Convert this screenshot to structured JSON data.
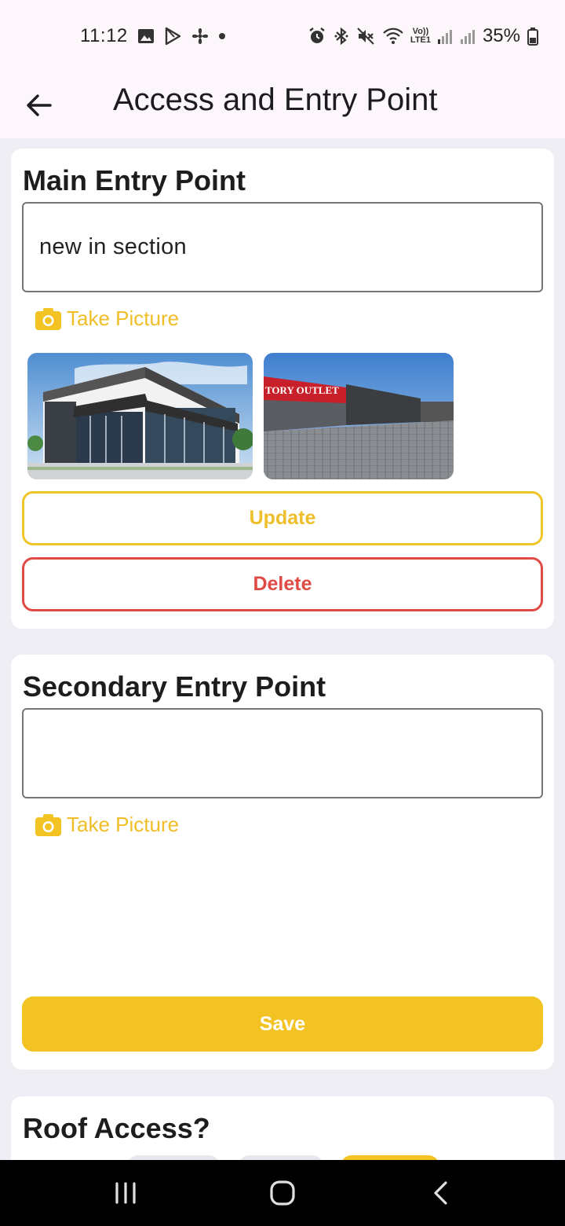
{
  "status_bar": {
    "time": "11:12",
    "battery": "35%",
    "icons": [
      "image-icon",
      "play-store-icon",
      "fan-icon",
      "dot-icon",
      "alarm-icon",
      "bluetooth-icon",
      "mute-icon",
      "wifi-icon",
      "volte-icon",
      "signal-icon",
      "signal-icon",
      "battery-icon"
    ],
    "volte_text": "Vo)) LTE1"
  },
  "app_bar": {
    "title": "Access and Entry Point",
    "back_icon": "arrow-left-icon"
  },
  "main_entry": {
    "heading": "Main Entry Point",
    "text_value": "new in section",
    "take_picture_label": "Take Picture",
    "photos": [
      {
        "name": "modern-storefront-photo"
      },
      {
        "name": "factory-outlet-photo",
        "sign_text": "TORY OUTLET"
      }
    ],
    "update_label": "Update",
    "delete_label": "Delete"
  },
  "secondary_entry": {
    "heading": "Secondary Entry Point",
    "text_value": "",
    "take_picture_label": "Take Picture",
    "save_label": "Save"
  },
  "roof_access": {
    "heading": "Roof Access?"
  },
  "colors": {
    "accent_yellow": "#f2c323",
    "delete_red": "#e04a44",
    "background": "#efeef4",
    "card": "#ffffff"
  },
  "nav_bar": {
    "items": [
      "recents-icon",
      "home-icon",
      "back-icon"
    ]
  }
}
